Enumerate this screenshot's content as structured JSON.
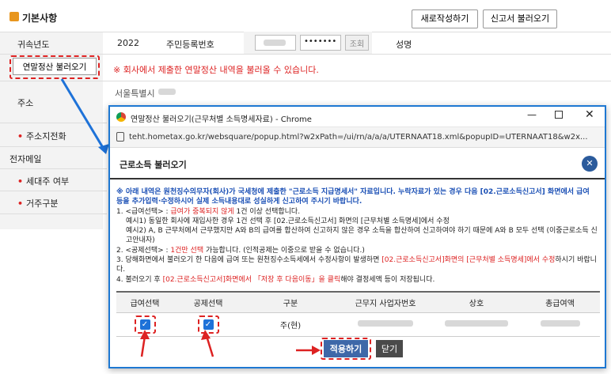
{
  "header": {
    "title": "기본사항",
    "new_button": "새로작성하기",
    "load_button": "신고서 불러오기"
  },
  "form": {
    "year_label": "귀속년도",
    "year_value": "2022",
    "rrn_label": "주민등록번호",
    "rrn_masked": "•••••••",
    "lookup_button": "조회",
    "name_label": "성명",
    "settlement_button": "연말정산 불러오기",
    "settlement_notice": "※ 회사에서 제출한 연말정산 내역을 불러올 수 있습니다.",
    "address_label": "주소",
    "address_value": "서울특별시",
    "phone_label": "주소지전화",
    "email_label": "전자메일",
    "household_label": "세대주 여부",
    "residence_label": "거주구분"
  },
  "popup": {
    "window_title": "연말정산 불러오기(근무처별 소득명세자료) - Chrome",
    "url": "teht.hometax.go.kr/websquare/popup.html?w2xPath=/ui/rn/a/a/a/UTERNAAT18.xml&popupID=UTERNAAT18&w2x...",
    "dialog_title": "근로소득 불러오기",
    "notice_main": "※ 아래 내역은 원천징수의무자(회사)가 국세청에 제출한 \"근로소득 지급명세서\" 자료입니다. 누락자료가 있는 경우 다음 [02.근로소득신고서] 화면에서 급여 등을 추가입력·수정하시어 실제 소득내용대로 성실하게 신고하여 주시기 바랍니다.",
    "item1_prefix": "1. <급여선택> : ",
    "item1_red": "급여가 중복되지 않게",
    "item1_suffix": " 1건 이상 선택합니다.",
    "item1_ex1": "예시1) 동일한 회사에 재입사한 경우 1건 선택 후 [02.근로소득신고서] 화면의 [근무처별 소득명세]에서 수정",
    "item1_ex2": "예시2) A, B 근무처에서 근무했지만 A와 B의 급여를 합산하여 신고하지 않은 경우 소득을 합산하여 신고하여야 하기 때문에 A와 B 모두 선택 (이중근로소득 신고안내자)",
    "item2_prefix": "2. <공제선택> : ",
    "item2_red": "1건만 선택",
    "item2_suffix": " 가능합니다. (인적공제는 이중으로 받을 수 없습니다.)",
    "item3_prefix": "3. 당해화면에서 불러오기 한 다음에 급여 또는 원천징수소득세에서 수정사항이 발생하면 ",
    "item3_red": "[02.근로소득신고서]화면의 [근무처별 소득명세]에서 수정",
    "item3_suffix": "하시기 바랍니다.",
    "item4_prefix": "4. 불러오기 후 ",
    "item4_red": "[02.근로소득신고서]화면에서 「저장 후 다음이동」을 클릭",
    "item4_suffix": "해야 결정세액 등이 저장됩니다.",
    "table": {
      "headers": [
        "급여선택",
        "공제선택",
        "구분",
        "근무지 사업자번호",
        "상호",
        "총급여액"
      ],
      "row": {
        "type": "주(현)"
      }
    },
    "apply_button": "적용하기",
    "close_button": "닫기"
  },
  "colors": {
    "accent": "#1e78d2",
    "alert": "#dd2222",
    "apply": "#3e68a8"
  }
}
